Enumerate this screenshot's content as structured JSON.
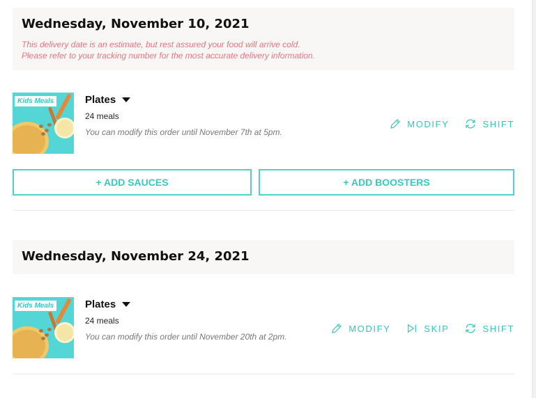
{
  "deliveries": [
    {
      "date": "Wednesday, November 10, 2021",
      "note_line1": "This delivery date is an estimate, but rest assured your food will arrive cold.",
      "note_line2": "Please refer to your tracking number for the most accurate delivery information.",
      "thumbnail_tag": "Kids Meals",
      "plan": "Plates",
      "meals": "24 meals",
      "deadline": "You can modify this order until November 7th at 5pm.",
      "actions": {
        "modify": "MODIFY",
        "shift": "SHIFT"
      },
      "addons": {
        "sauces": "+ ADD SAUCES",
        "boosters": "+ ADD BOOSTERS"
      }
    },
    {
      "date": "Wednesday, November 24, 2021",
      "thumbnail_tag": "Kids Meals",
      "plan": "Plates",
      "meals": "24 meals",
      "deadline": "You can modify this order until November 20th at 2pm.",
      "actions": {
        "modify": "MODIFY",
        "skip": "SKIP",
        "shift": "SHIFT"
      }
    }
  ],
  "colors": {
    "accent": "#34c5bf",
    "note": "#e8747f",
    "banner_bg": "#f8f7f5"
  },
  "icons": {
    "modify": "pencil-icon",
    "skip": "skip-icon",
    "shift": "refresh-icon",
    "dropdown": "caret-down-icon"
  }
}
